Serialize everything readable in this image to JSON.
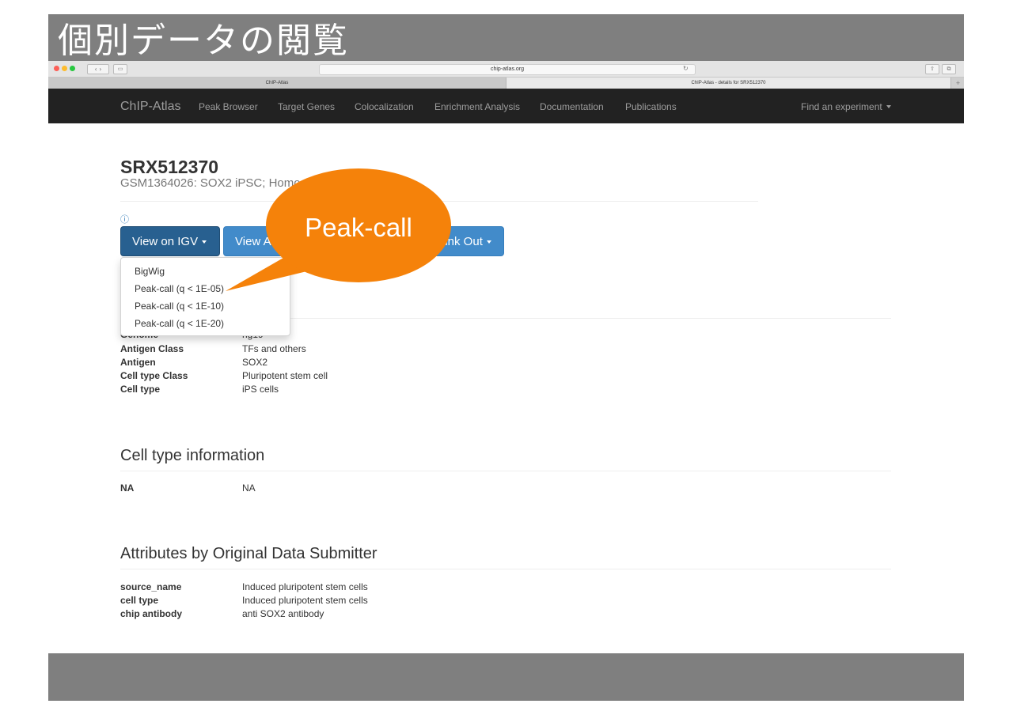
{
  "slide": {
    "title": "個別データの閲覧",
    "callout_label": "Peak-call",
    "callout_color": "#f5820a"
  },
  "browser": {
    "nav_glyph": "‹ ›",
    "address": "chip-atlas.org",
    "tabs": [
      {
        "label": "ChIP-Atlas"
      },
      {
        "label": "ChIP-Atlas - details for SRX512370"
      }
    ],
    "new_tab": "+"
  },
  "navbar": {
    "brand": "ChIP-Atlas",
    "items": [
      "Peak Browser",
      "Target Genes",
      "Colocalization",
      "Enrichment Analysis",
      "Documentation",
      "Publications"
    ],
    "find_experiment": "Find an experiment"
  },
  "experiment": {
    "id": "SRX512370",
    "subtitle": "GSM1364026: SOX2 iPSC; Homo sapiens; ChIP-Seq"
  },
  "info_icon": "ⓘ",
  "buttons": {
    "view_igv": "View on IGV",
    "view_analysis": "View Analysis Data",
    "link_out": "Link Out"
  },
  "igv_dropdown": [
    "BigWig",
    "Peak-call (q < 1E-05)",
    "Peak-call (q < 1E-10)",
    "Peak-call (q < 1E-20)"
  ],
  "metadata": [
    {
      "key": "Genome",
      "value": "hg19"
    },
    {
      "key": "Antigen Class",
      "value": "TFs and others"
    },
    {
      "key": "Antigen",
      "value": "SOX2"
    },
    {
      "key": "Cell type Class",
      "value": "Pluripotent stem cell"
    },
    {
      "key": "Cell type",
      "value": "iPS cells"
    }
  ],
  "cell_type_info": {
    "title": "Cell type information",
    "rows": [
      {
        "key": "NA",
        "value": "NA"
      }
    ]
  },
  "attributes": {
    "title": "Attributes by Original Data Submitter",
    "rows": [
      {
        "key": "source_name",
        "value": "Induced pluripotent stem cells"
      },
      {
        "key": "cell type",
        "value": "Induced pluripotent stem cells"
      },
      {
        "key": "chip antibody",
        "value": "anti SOX2 antibody"
      }
    ]
  }
}
